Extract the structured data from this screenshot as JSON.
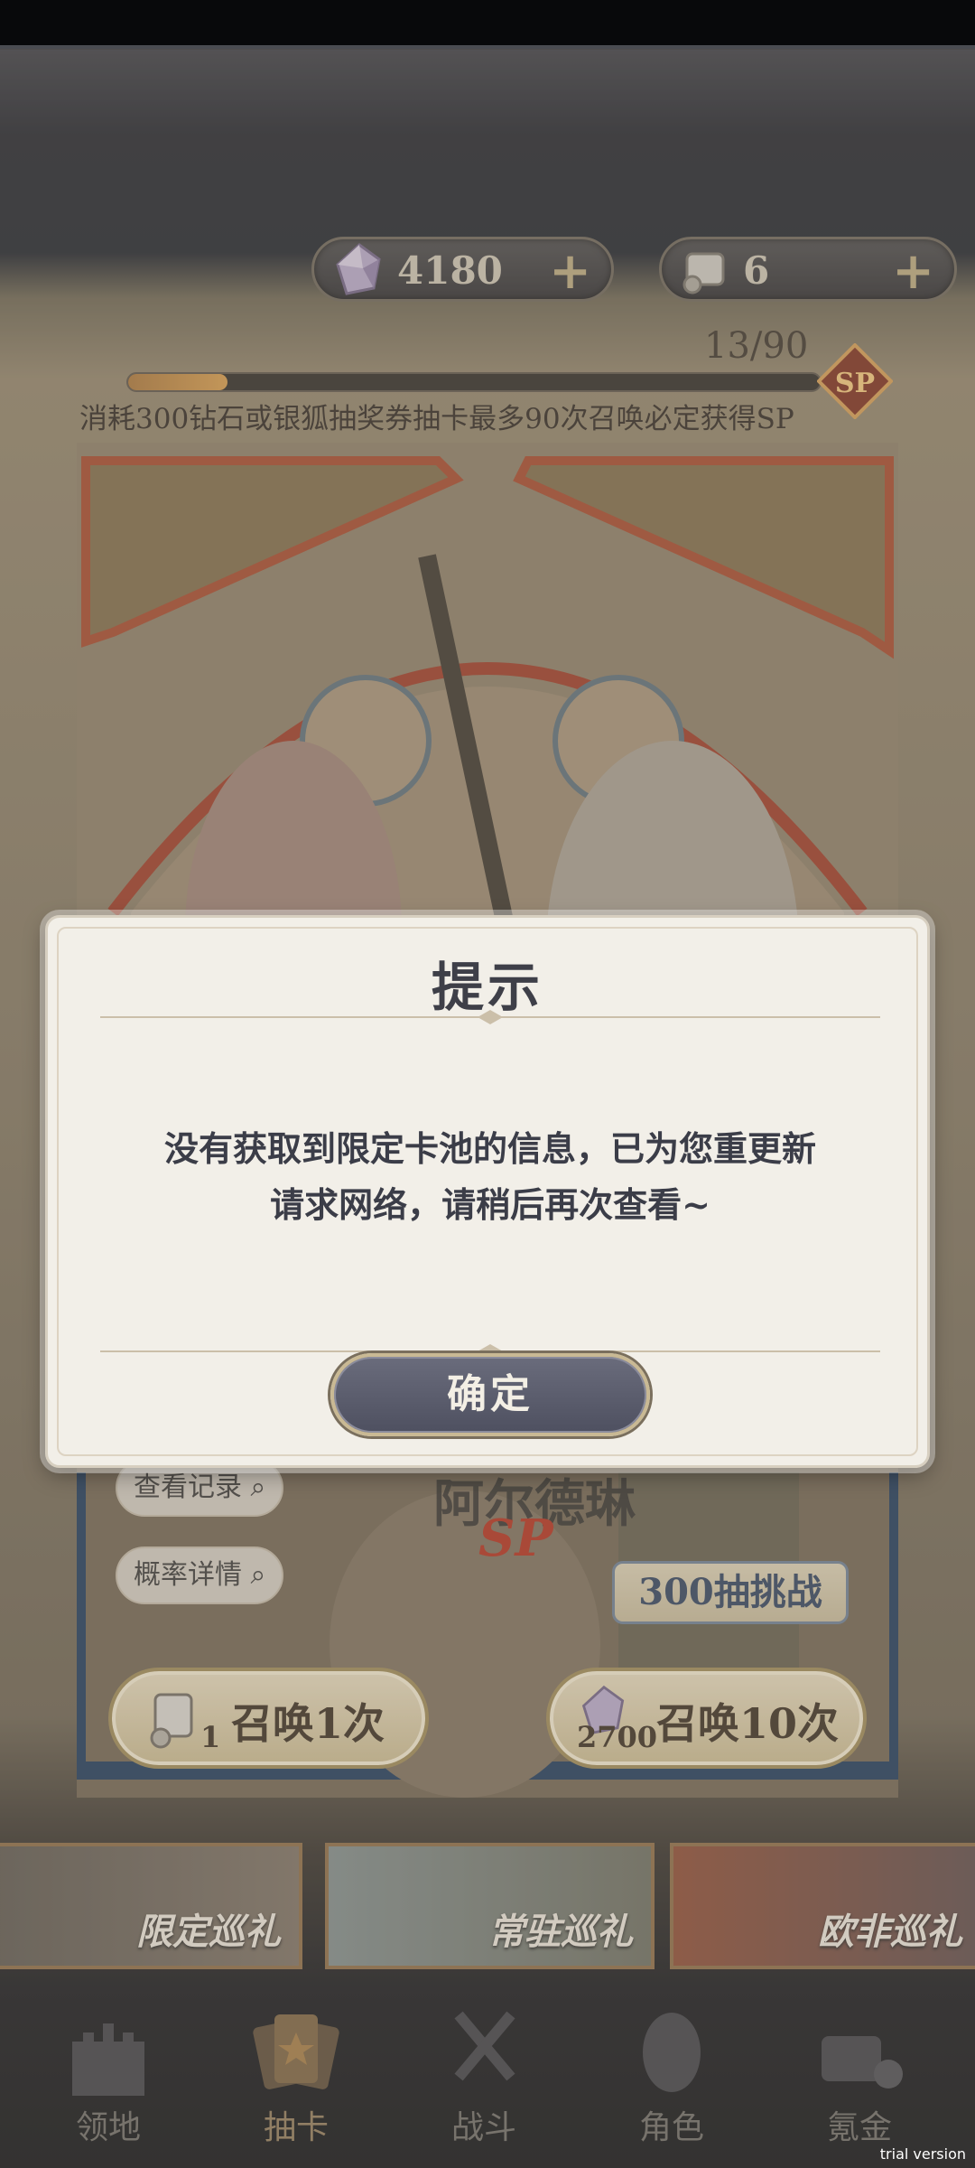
{
  "currencies": {
    "diamond_value": "4180",
    "ticket_value": "6",
    "add_symbol": "+"
  },
  "progress": {
    "text": "13/90",
    "fraction": 0.144,
    "badge": "SP"
  },
  "banner": {
    "note": "消耗300钻石或银狐抽奖券抽卡最多90次召唤必定获得SP"
  },
  "under_modal": {
    "view_records": "查看记录",
    "probability_details": "概率详情",
    "character_name": "阿尔德琳",
    "character_rarity": "SP",
    "challenge_label": "300抽挑战",
    "summon_one_label": "召唤1次",
    "summon_one_cost": "1",
    "summon_ten_label": "召唤10次",
    "summon_ten_cost": "2700"
  },
  "pools": [
    {
      "label": "限定巡礼"
    },
    {
      "label": "常驻巡礼"
    },
    {
      "label": "欧非巡礼"
    }
  ],
  "nav": [
    {
      "label": "领地",
      "icon": "castle-icon"
    },
    {
      "label": "抽卡",
      "icon": "cards-icon"
    },
    {
      "label": "战斗",
      "icon": "crossed-swords-icon"
    },
    {
      "label": "角色",
      "icon": "character-icon"
    },
    {
      "label": "氪金",
      "icon": "treasure-icon"
    }
  ],
  "modal": {
    "title": "提示",
    "message_line1": "没有获取到限定卡池的信息，已为您重更新",
    "message_line2": "请求网络，请稍后再次查看~",
    "confirm_label": "确定"
  },
  "watermark": "trial version",
  "colors": {
    "modal_bg": "#f2efe8",
    "confirm_bg": "#5c5e6e",
    "gold_border": "#c9b994"
  }
}
